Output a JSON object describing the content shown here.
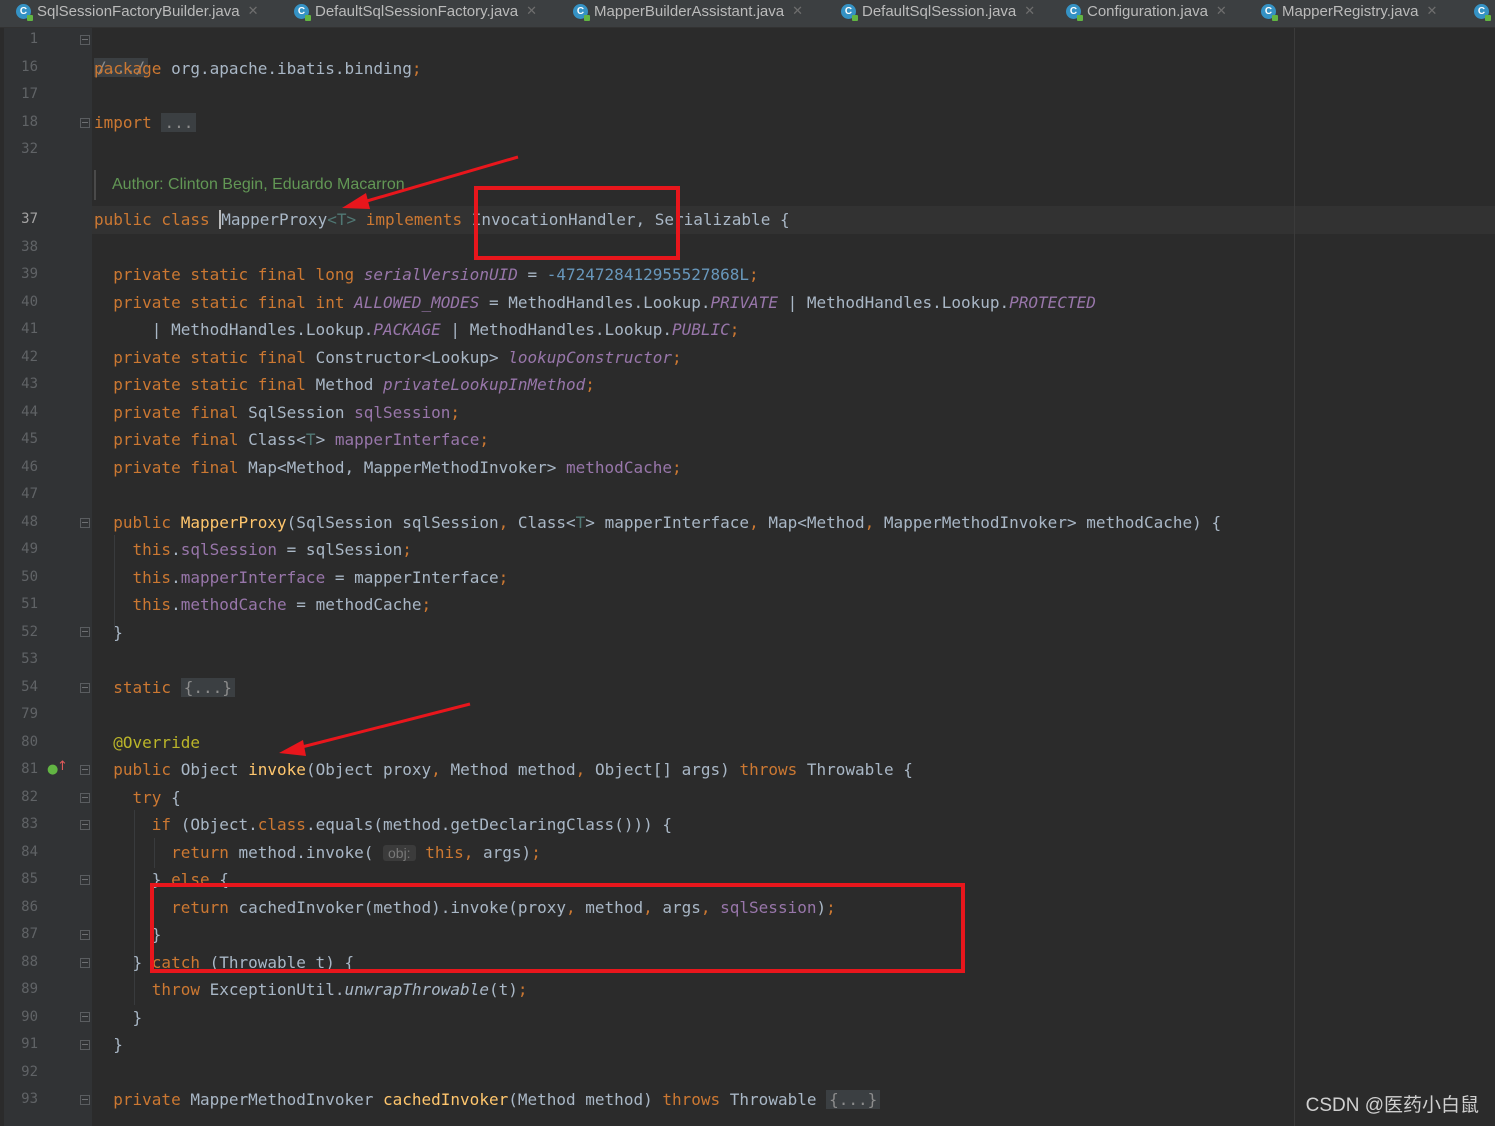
{
  "tabs": [
    {
      "label": "SqlSessionFactoryBuilder.java"
    },
    {
      "label": "DefaultSqlSessionFactory.java"
    },
    {
      "label": "MapperBuilderAssistant.java"
    },
    {
      "label": "DefaultSqlSession.java"
    },
    {
      "label": "Configuration.java"
    },
    {
      "label": "MapperRegistry.java"
    }
  ],
  "tab_icon": "java-class-icon",
  "line_numbers": [
    "1",
    "16",
    "17",
    "18",
    "32",
    "37",
    "38",
    "39",
    "40",
    "41",
    "42",
    "43",
    "44",
    "45",
    "46",
    "47",
    "48",
    "49",
    "50",
    "51",
    "52",
    "53",
    "54",
    "79",
    "80",
    "81",
    "82",
    "83",
    "84",
    "85",
    "86",
    "87",
    "88",
    "89",
    "90",
    "91",
    "92",
    "93"
  ],
  "author": "Author: Clinton Begin, Eduardo Macarron",
  "code": {
    "fold_comment": "/.../",
    "package_kw": "package",
    "package_name": " org.apache.ibatis.binding",
    "import_kw": "import",
    "fold_dots": "...",
    "fold_block": "{...}",
    "class_decl": {
      "prefix": "public class ",
      "name": "MapperProxy",
      "generic": "<T>",
      "implements": " implements ",
      "rest": "InvocationHandler, Serializable {"
    },
    "serial_value": "-4724728412955527868L",
    "obj_hint": "obj:"
  },
  "watermark": "CSDN @医药小白鼠",
  "colors": {
    "background": "#2b2b2b",
    "keyword": "#cc7832",
    "method": "#ffc66d",
    "field": "#9876aa",
    "annotation_box": "#e8161c"
  }
}
